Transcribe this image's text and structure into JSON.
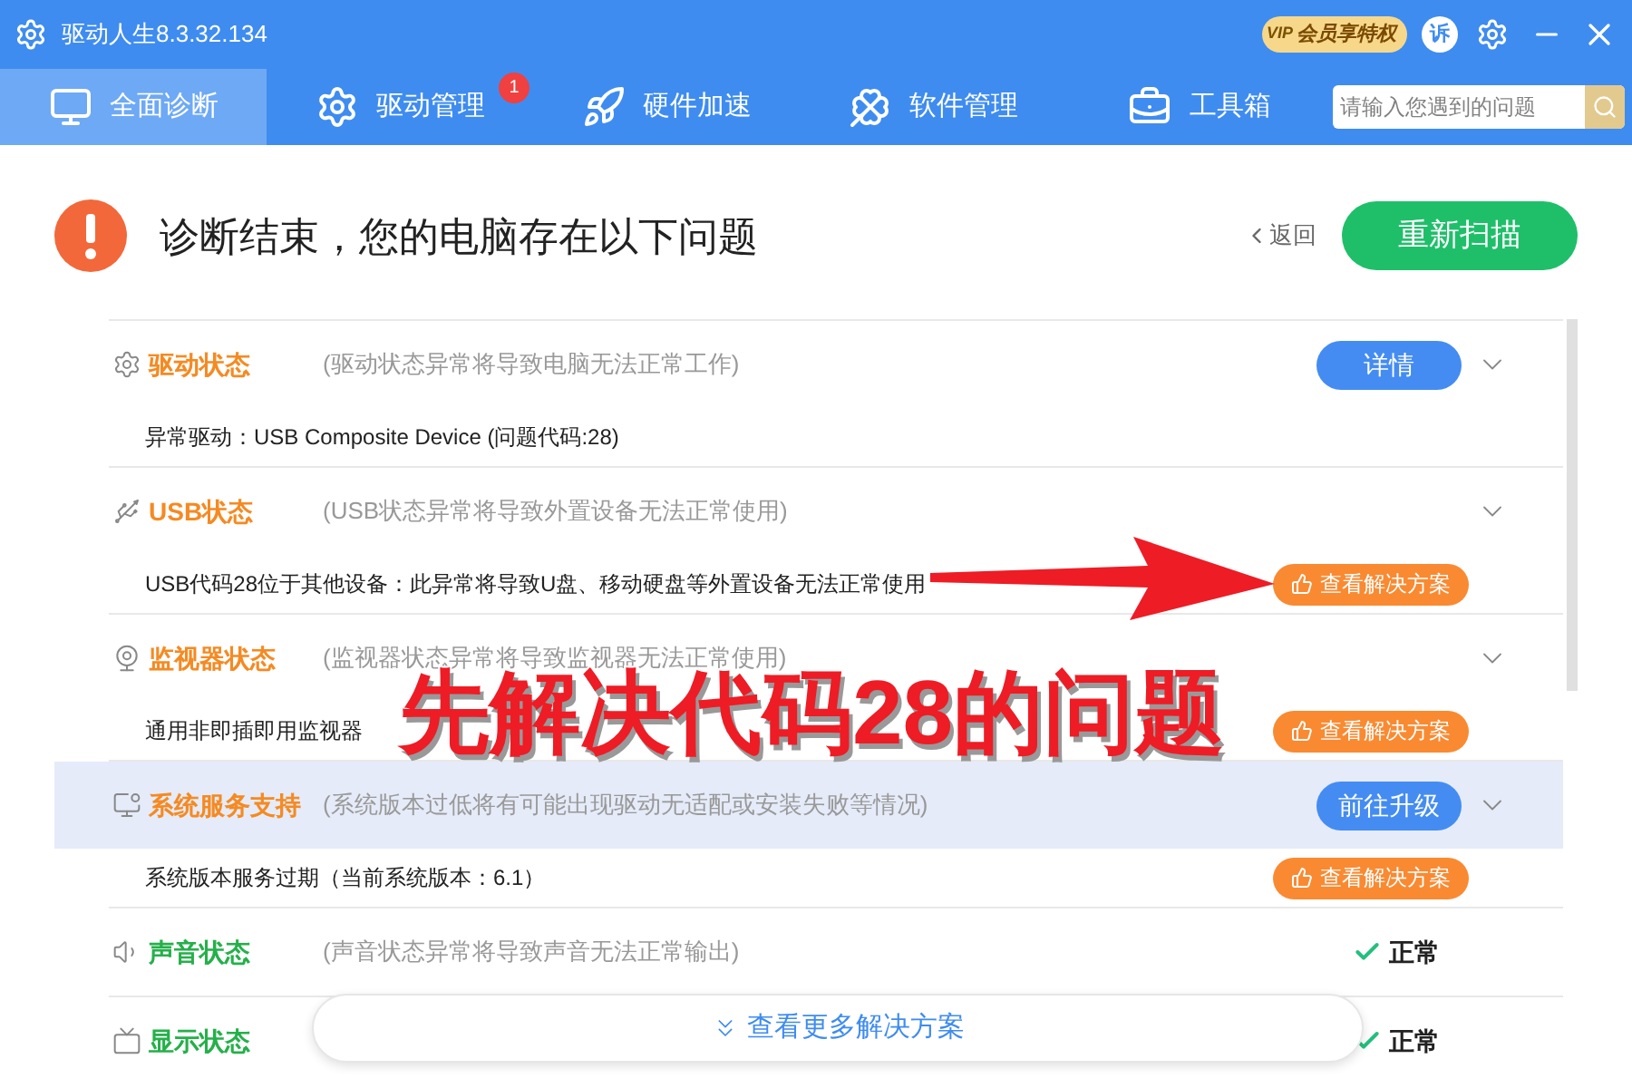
{
  "window": {
    "title": "驱动人生8.3.32.134",
    "vip_badge": {
      "label": "会员享特权",
      "tag": "VIP"
    },
    "feedback": "诉"
  },
  "tabs": [
    {
      "label": "全面诊断",
      "selected": true
    },
    {
      "label": "驱动管理",
      "selected": false,
      "badge": "1"
    },
    {
      "label": "硬件加速",
      "selected": false
    },
    {
      "label": "软件管理",
      "selected": false
    },
    {
      "label": "工具箱",
      "selected": false
    }
  ],
  "search": {
    "placeholder": "请输入您遇到的问题"
  },
  "header": {
    "title": "诊断结束，您的电脑存在以下问题",
    "back": "返回",
    "rescan": "重新扫描"
  },
  "items": [
    {
      "kind": "issue",
      "title": "驱动状态",
      "description": "(驱动状态异常将导致电脑无法正常工作)",
      "selected": false,
      "action": "详情",
      "detail": "异常驱动：USB Composite Device (问题代码:28)"
    },
    {
      "kind": "issue",
      "title": "USB状态",
      "description": "(USB状态异常将导致外置设备无法正常使用)",
      "selected": false,
      "detail": "USB代码28位于其他设备：此异常将导致U盘、移动硬盘等外置设备无法正常使用",
      "detail_action": "查看解决方案"
    },
    {
      "kind": "issue",
      "title": "监视器状态",
      "description": "(监视器状态异常将导致监视器无法正常使用)",
      "selected": false,
      "detail": "通用非即插即用监视器",
      "detail_action": "查看解决方案"
    },
    {
      "kind": "issue",
      "title": "系统服务支持",
      "description": "(系统版本过低将有可能出现驱动无适配或安装失败等情况)",
      "selected": true,
      "action": "前往升级",
      "detail": "系统版本服务过期（当前系统版本：6.1）",
      "detail_action": "查看解决方案"
    },
    {
      "kind": "ok",
      "title": "声音状态",
      "description": "(声音状态异常将导致声音无法正常输出)",
      "selected": false,
      "status_text": "正常"
    },
    {
      "kind": "ok",
      "title": "显示状态",
      "selected": false,
      "status_text": "正常"
    }
  ],
  "more_button": "查看更多解决方案",
  "annotation": {
    "text": "先解决代码28的问题"
  }
}
